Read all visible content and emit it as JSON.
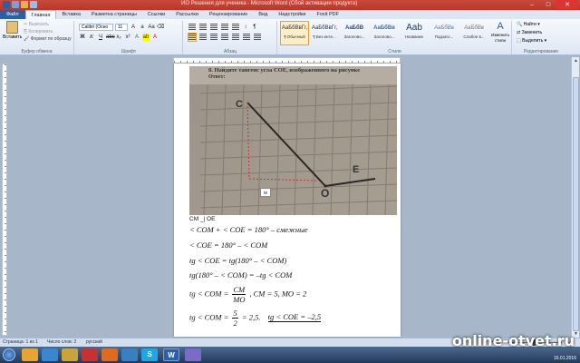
{
  "window": {
    "title": "ИО Решения для ученика - Microsoft Word (Сбой активации продукта)"
  },
  "tabs": [
    "Файл",
    "Главная",
    "Вставка",
    "Разметка страницы",
    "Ссылки",
    "Рассылки",
    "Рецензирование",
    "Вид",
    "Надстройки",
    "Foxit PDF"
  ],
  "ribbon": {
    "clipboard": {
      "paste": "Вставить",
      "cut": "Вырезать",
      "copy": "Копировать",
      "format_painter": "Формат по образцу",
      "label": "Буфер обмена"
    },
    "font": {
      "name": "Calibri (Осно",
      "size": "11",
      "label": "Шрифт"
    },
    "paragraph": {
      "label": "Абзац"
    },
    "styles": {
      "items": [
        {
          "sample": "АаБбВвГг,",
          "name": "¶ Обычный"
        },
        {
          "sample": "АаБбВвГг,",
          "name": "¶ Без инте..."
        },
        {
          "sample": "АаБбВ",
          "name": "Заголово..."
        },
        {
          "sample": "АаБбВв",
          "name": "Заголово..."
        },
        {
          "sample": "Aab",
          "name": "Название"
        },
        {
          "sample": "АаБбВв",
          "name": "Подзаго..."
        },
        {
          "sample": "АаБбВв",
          "name": "Слабое в..."
        }
      ],
      "change": "Изменить стили",
      "label": "Стили"
    },
    "editing": {
      "find": "Найти",
      "replace": "Заменить",
      "select": "Выделить",
      "label": "Редактирование"
    }
  },
  "document": {
    "photo_heading": "8.   Найдите тангенс угла COE, изображенного на рисунке",
    "photo_answer": "Ответ:",
    "figure_labels": {
      "c": "C",
      "o": "O",
      "e": "E"
    },
    "legend": "M",
    "lines": {
      "l0": "CM _| OE",
      "l1": "< COM + < COE = 180° –    смежные",
      "l2": "< COE = 180° – < COM",
      "l3": "tg < COE = tg(180° – < COM)",
      "l4": "tg(180° – < COM) = –tg < COM",
      "l5_a": "tg < COM =",
      "l5_num": "CM",
      "l5_den": "MO",
      "l5_b": ",    CM = 5,    MO = 2",
      "l6_a": "tg < COM =",
      "l6_num": "5",
      "l6_den": "2",
      "l6_b": "= 2,5.",
      "l6_ans": "tg < COE = –2,5"
    }
  },
  "status": {
    "page": "Страница: 1 из 1",
    "words": "Число слов: 2",
    "lang": "русский",
    "zoom": "140%"
  },
  "taskbar": {
    "word_icon": "W",
    "skype_icon": "S",
    "time": "16.01.2016"
  },
  "watermark": "online-otvet.ru",
  "colors": {
    "title": "#c94a3c",
    "file_tab": "#2c5fa8",
    "ribbon": "#dde7f4",
    "taskbar": "#2a4266"
  }
}
